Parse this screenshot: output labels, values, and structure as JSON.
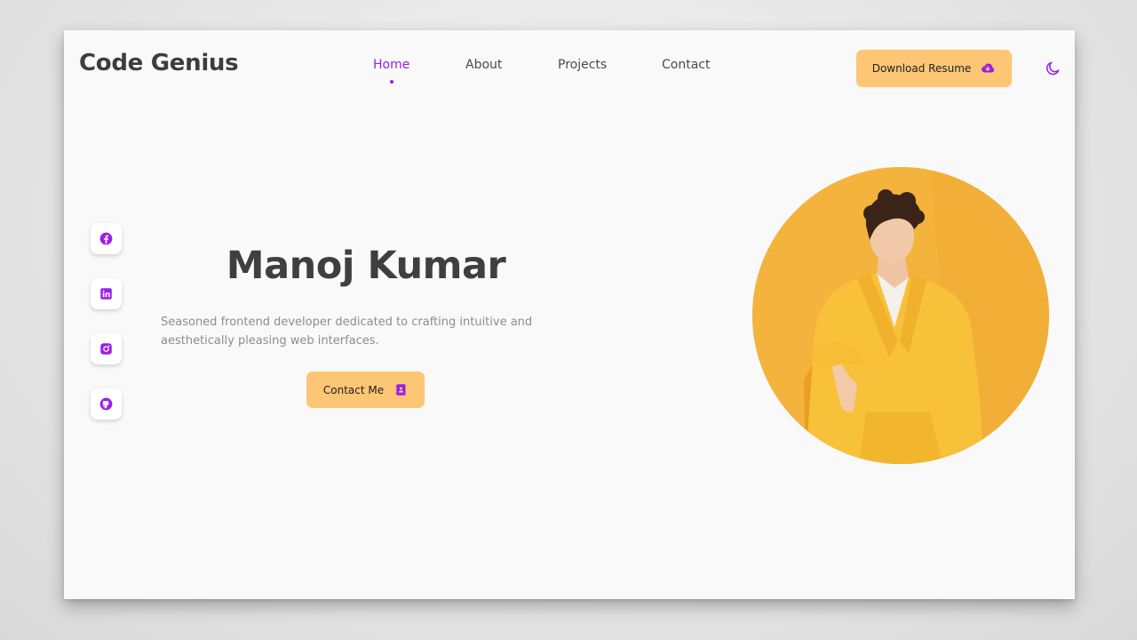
{
  "header": {
    "logo": "Code Genius",
    "nav": [
      {
        "label": "Home",
        "active": true
      },
      {
        "label": "About",
        "active": false
      },
      {
        "label": "Projects",
        "active": false
      },
      {
        "label": "Contact",
        "active": false
      }
    ],
    "resume_label": "Download Resume",
    "resume_icon": "cloud-download-icon",
    "theme_icon": "moon-icon"
  },
  "hero": {
    "name": "Manoj Kumar",
    "description": "Seasoned frontend developer dedicated to crafting intuitive and aesthetically pleasing web interfaces.",
    "contact_label": "Contact Me",
    "contact_icon": "contact-book-icon"
  },
  "socials": [
    {
      "name": "facebook-icon"
    },
    {
      "name": "linkedin-icon"
    },
    {
      "name": "instagram-icon"
    },
    {
      "name": "github-icon"
    }
  ],
  "colors": {
    "accent": "#9b1fe8",
    "button": "#fdc674",
    "portrait_bg": "#f3b33c",
    "heading": "#3f3f3f",
    "body_text": "#8d8d8d"
  }
}
